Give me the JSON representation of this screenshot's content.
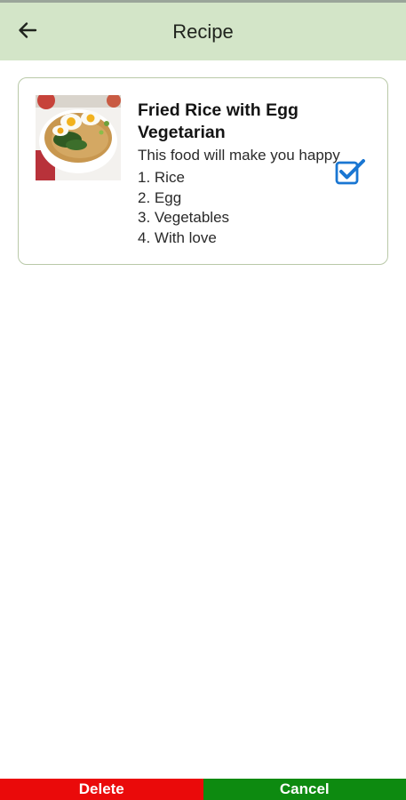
{
  "app_bar": {
    "title": "Recipe",
    "back_icon": "arrow-left-icon"
  },
  "recipe": {
    "image_icon": "fried-rice-photo",
    "title": "Fried Rice with Egg Vegetarian",
    "description": "This food will make you happy",
    "ingredients": [
      "1. Rice",
      "2. Egg",
      "3. Vegetables",
      "4. With love"
    ],
    "checkbox_icon": "checkbox-checked-icon"
  },
  "actions": {
    "delete_label": "Delete",
    "cancel_label": "Cancel"
  },
  "colors": {
    "app_bar_bg": "#d3e5c8",
    "card_border": "#b9c9a8",
    "delete_bg": "#ea0a0a",
    "cancel_bg": "#0d8a10",
    "checkbox": "#1976d2"
  }
}
